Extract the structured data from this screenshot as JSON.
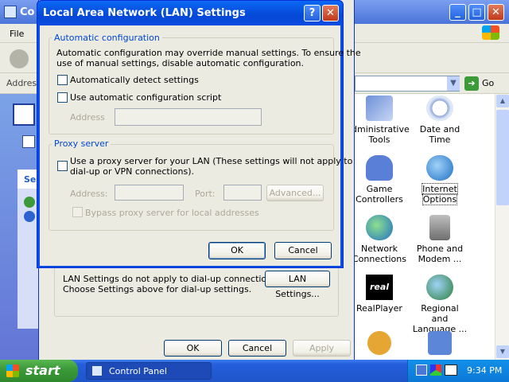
{
  "background_window": {
    "title": "Co",
    "menu_file": "File",
    "address_label": "Addres",
    "address_go": "Go",
    "side_label": "Se",
    "icons": [
      {
        "icon": "administrative-tools-icon",
        "label_line1": "dministrative",
        "label_line2": "Tools"
      },
      {
        "icon": "date-time-icon",
        "label_line1": "Date and Time",
        "label_line2": ""
      },
      {
        "icon": "game-controllers-icon",
        "label_line1": "Game",
        "label_line2": "Controllers"
      },
      {
        "icon": "internet-options-icon",
        "label_line1": "Internet",
        "label_line2": "Options"
      },
      {
        "icon": "network-connections-icon",
        "label_line1": "Network",
        "label_line2": "Connections"
      },
      {
        "icon": "phone-modem-icon",
        "label_line1": "Phone and",
        "label_line2": "Modem ..."
      },
      {
        "icon": "realplayer-icon",
        "label_line1": "RealPlayer",
        "label_line2": ""
      },
      {
        "icon": "regional-language-icon",
        "label_line1": "Regional and",
        "label_line2": "Language ..."
      }
    ]
  },
  "internet_props": {
    "lan_note_line1": "LAN Settings do not apply to dial-up connections.",
    "lan_note_line2": "Choose Settings above for dial-up settings.",
    "lan_settings_button": "LAN Settings...",
    "ok": "OK",
    "cancel": "Cancel",
    "apply": "Apply"
  },
  "dialog": {
    "title": "Local Area Network (LAN) Settings",
    "auto_group": "Automatic configuration",
    "auto_desc_line1": "Automatic configuration may override manual settings.  To ensure the",
    "auto_desc_line2": "use of manual settings, disable automatic configuration.",
    "auto_detect": "Automatically detect settings",
    "auto_script": "Use automatic configuration script",
    "address_label": "Address",
    "address_value": "",
    "proxy_group": "Proxy server",
    "use_proxy_line1": "Use a proxy server for your LAN (These settings will not apply to",
    "use_proxy_line2": "dial-up or VPN connections).",
    "proxy_address_label": "Address:",
    "port_label": "Port:",
    "advanced_button": "Advanced...",
    "bypass": "Bypass proxy server for local addresses",
    "ok": "OK",
    "cancel": "Cancel",
    "help_glyph": "?",
    "close_glyph": "✕"
  },
  "taskbar": {
    "start": "start",
    "task_label": "Control Panel",
    "clock": "9:34 PM"
  },
  "colors": {
    "dialog_title_blue": "#0a4de0",
    "xp_face": "#ecebe2",
    "group_title": "#0046d5",
    "taskbar_blue": "#245edb",
    "start_green": "#3c9a3a"
  }
}
